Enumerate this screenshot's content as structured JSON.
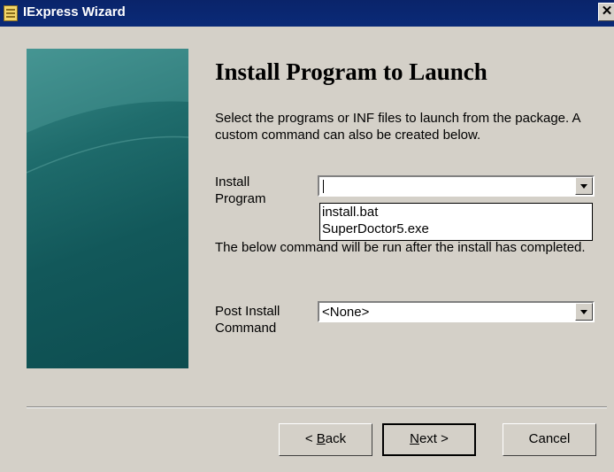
{
  "window": {
    "title": "IExpress Wizard",
    "close_label": "✕"
  },
  "page": {
    "heading": "Install Program to Launch",
    "description": "Select the programs or INF files to launch from the package.  A custom command can also be created below."
  },
  "install_program": {
    "label_line1": "Install",
    "label_line2": "Program",
    "value": "",
    "options": [
      "install.bat",
      "SuperDoctor5.exe"
    ]
  },
  "below_text": "The below command will be run after the install has completed.",
  "post_install": {
    "label_line1": "Post Install",
    "label_line2": "Command",
    "value": "<None>"
  },
  "buttons": {
    "back_prefix": "< ",
    "back_mnemonic": "B",
    "back_rest": "ack",
    "next_mnemonic": "N",
    "next_rest": "ext >",
    "cancel": "Cancel"
  }
}
